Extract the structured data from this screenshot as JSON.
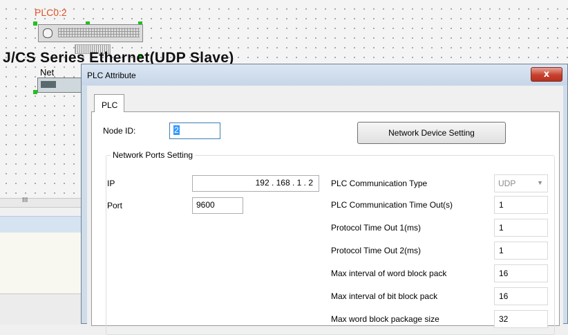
{
  "canvas": {
    "plc_label": "PLC0:2",
    "series_title": "J/CS Series Ethernet(UDP Slave)",
    "net_label": "Net",
    "scroll_marker": "III"
  },
  "dialog": {
    "title": "PLC Attribute",
    "close_label": "x",
    "tab_label": "PLC",
    "node_id_label": "Node ID:",
    "node_id_value": "2",
    "network_device_button": "Network Device Setting",
    "ports_group_label": "Network Ports Setting",
    "ip_label": "IP",
    "ip_value": "192  .  168  .  1   .   2",
    "port_label": "Port",
    "port_value": "9600",
    "comm_type_label": "PLC Communication Type",
    "comm_type_value": "UDP",
    "settings": [
      {
        "label": "PLC Communication Time Out(s)",
        "value": "1"
      },
      {
        "label": "Protocol Time Out 1(ms)",
        "value": "1"
      },
      {
        "label": "Protocol Time Out 2(ms)",
        "value": "1"
      },
      {
        "label": "Max interval of word block pack",
        "value": "16"
      },
      {
        "label": "Max interval of bit block pack",
        "value": "16"
      },
      {
        "label": "Max word block package size",
        "value": "32"
      }
    ]
  },
  "icons": {
    "close": "close-icon",
    "dropdown": "chevron-down-icon"
  },
  "colors": {
    "plc_label": "#e05020",
    "selection_handle": "#22c022",
    "close_button": "#c7402e",
    "text_selection": "#3399ff"
  }
}
